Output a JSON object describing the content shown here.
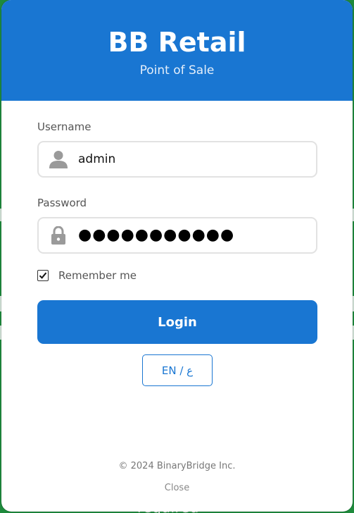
{
  "header": {
    "title": "BB Retail",
    "subtitle": "Point of Sale"
  },
  "form": {
    "username_label": "Username",
    "username_value": "admin",
    "password_label": "Password",
    "password_masked": "●●●●●●●●●●●",
    "remember_label": "Remember me",
    "remember_checked": true,
    "login_label": "Login",
    "language_label": "EN / ع"
  },
  "footer": {
    "copyright": "© 2024 BinaryBridge Inc.",
    "close_label": "Close"
  },
  "background": {
    "partial_text": "required"
  },
  "icons": {
    "username": "user-icon",
    "password": "lock-icon",
    "checkbox": "check-icon"
  },
  "colors": {
    "primary": "#1976d2",
    "background_app": "#1e8a3c"
  }
}
